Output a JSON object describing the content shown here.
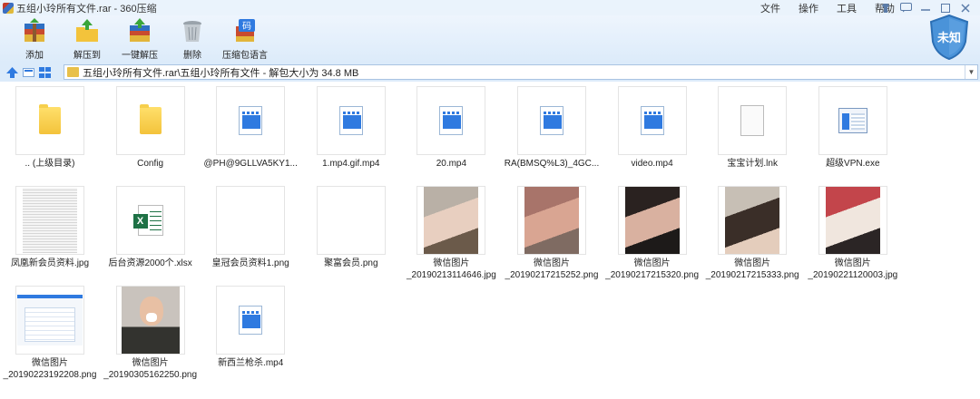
{
  "window": {
    "title": "五组小玲所有文件.rar - 360压缩",
    "menu": [
      "文件",
      "操作",
      "工具",
      "帮助"
    ],
    "controls": [
      "skin-icon",
      "chat-icon",
      "minimize-icon",
      "maximize-icon",
      "close-icon"
    ]
  },
  "toolbar": {
    "tools": [
      {
        "label": "添加",
        "icon": "add-archive-icon"
      },
      {
        "label": "解压到",
        "icon": "extract-to-icon"
      },
      {
        "label": "一键解压",
        "icon": "one-click-extract-icon"
      },
      {
        "label": "删除",
        "icon": "delete-icon"
      },
      {
        "label": "压缩包语言",
        "icon": "archive-language-icon"
      }
    ],
    "status_badge": "未知",
    "accent": "#2f7ae0"
  },
  "address": {
    "path": "五组小玲所有文件.rar\\五组小玲所有文件 - 解包大小为 34.8 MB"
  },
  "files": [
    {
      "name": ".. (上级目录)",
      "type": "folder"
    },
    {
      "name": "Config",
      "type": "folder"
    },
    {
      "name": "@PH@9GLLVA5KY1...",
      "type": "video"
    },
    {
      "name": "1.mp4.gif.mp4",
      "type": "video"
    },
    {
      "name": "20.mp4",
      "type": "video"
    },
    {
      "name": "RA(BMSQ%L3)_4GC...",
      "type": "video"
    },
    {
      "name": "video.mp4",
      "type": "video"
    },
    {
      "name": "宝宝计划.lnk",
      "type": "doc"
    },
    {
      "name": "超级VPN.exe",
      "type": "exe"
    },
    {
      "name": "凤凰新会员资料.jpg",
      "type": "sheet"
    },
    {
      "name": "后台资源2000个.xlsx",
      "type": "xls"
    },
    {
      "name": "皇冠会员资料1.png",
      "type": "list"
    },
    {
      "name": "聚富会员.png",
      "type": "list"
    },
    {
      "name": "微信图片\n_20190213114646.jpg",
      "type": "photo",
      "colors": [
        "#b9b0a6",
        "#e8cfc0",
        "#6b5a4a"
      ]
    },
    {
      "name": "微信图片\n_20190217215252.png",
      "type": "photo",
      "colors": [
        "#a8746a",
        "#d9a592",
        "#7f6b62"
      ]
    },
    {
      "name": "微信图片\n_20190217215320.png",
      "type": "photo",
      "colors": [
        "#2a2220",
        "#d9b1a0",
        "#1d1a19"
      ]
    },
    {
      "name": "微信图片\n_20190217215333.png",
      "type": "photo",
      "colors": [
        "#c7bfb5",
        "#3a2e28",
        "#e4cdbc"
      ]
    },
    {
      "name": "微信图片\n_20190221120003.jpg",
      "type": "photo",
      "colors": [
        "#c3454b",
        "#f0e6de",
        "#2b2525"
      ]
    },
    {
      "name": "微信图片\n_20190223192208.png",
      "type": "screenshot"
    },
    {
      "name": "微信图片\n_20190305162250.png",
      "type": "face"
    },
    {
      "name": "新西兰枪杀.mp4",
      "type": "video"
    }
  ]
}
